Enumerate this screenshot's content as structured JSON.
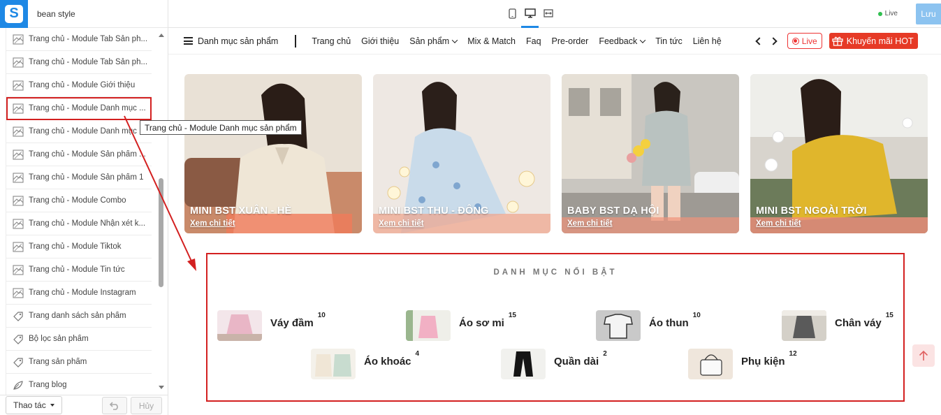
{
  "app": {
    "theme_name": "bean style",
    "save_label": "Lưu",
    "live_status": "Live",
    "action_label": "Thao tác",
    "cancel_label": "Hủy"
  },
  "sidebar": {
    "items": [
      {
        "label": "Trang chủ - Module Tab Sản ph...",
        "icon": "layout-icon"
      },
      {
        "label": "Trang chủ - Module Tab Sản ph...",
        "icon": "layout-icon"
      },
      {
        "label": "Trang chủ - Module Giới thiệu",
        "icon": "layout-icon"
      },
      {
        "label": "Trang chủ - Module Danh mục ...",
        "icon": "layout-icon",
        "selected": true
      },
      {
        "label": "Trang chủ - Module Danh mục ...",
        "icon": "layout-icon"
      },
      {
        "label": "Trang chủ - Module Sản phẩm ...",
        "icon": "layout-icon"
      },
      {
        "label": "Trang chủ - Module Sản phẩm 1",
        "icon": "layout-icon"
      },
      {
        "label": "Trang chủ - Module Combo",
        "icon": "layout-icon"
      },
      {
        "label": "Trang chủ - Module Nhận xét k...",
        "icon": "layout-icon"
      },
      {
        "label": "Trang chủ - Module Tiktok",
        "icon": "layout-icon"
      },
      {
        "label": "Trang chủ - Module Tin tức",
        "icon": "layout-icon"
      },
      {
        "label": "Trang chủ - Module Instagram",
        "icon": "layout-icon"
      },
      {
        "label": "Trang danh sách sản phẩm",
        "icon": "tag-icon"
      },
      {
        "label": "Bộ lọc sản phẩm",
        "icon": "tag-icon"
      },
      {
        "label": "Trang sản phẩm",
        "icon": "tag-icon"
      },
      {
        "label": "Trang blog",
        "icon": "blog-icon"
      }
    ],
    "tooltip": "Trang chủ - Module Danh mục sản phẩm"
  },
  "store": {
    "category_menu": "Danh mục sản phẩm",
    "nav": [
      {
        "label": "Trang chủ"
      },
      {
        "label": "Giới thiệu"
      },
      {
        "label": "Sản phẩm",
        "dropdown": true
      },
      {
        "label": "Mix & Match"
      },
      {
        "label": "Faq"
      },
      {
        "label": "Pre-order"
      },
      {
        "label": "Feedback",
        "dropdown": true
      },
      {
        "label": "Tin tức"
      },
      {
        "label": "Liên hệ"
      }
    ],
    "live_label": "Live",
    "promo_label": "Khuyến mãi HOT",
    "banners": [
      {
        "title": "MINI BST XUÂN - HÈ",
        "link": "Xem chi tiết"
      },
      {
        "title": "MINI BST THU - ĐÔNG",
        "link": "Xem chi tiết"
      },
      {
        "title": "BABY BST DẠ HỘI",
        "link": "Xem chi tiết"
      },
      {
        "title": "MINI BST NGOÀI TRỜI",
        "link": "Xem chi tiết"
      }
    ],
    "featured": {
      "title": "DANH MỤC NỔI BẬT",
      "categories": [
        {
          "name": "Váy đầm",
          "count": "10"
        },
        {
          "name": "Áo sơ mi",
          "count": "15"
        },
        {
          "name": "Áo thun",
          "count": "10"
        },
        {
          "name": "Chân váy",
          "count": "15"
        },
        {
          "name": "Áo khoác",
          "count": "4"
        },
        {
          "name": "Quần dài",
          "count": "2"
        },
        {
          "name": "Phụ kiện",
          "count": "12"
        }
      ]
    }
  },
  "colors": {
    "accent": "#1e88e5",
    "highlight": "#d32020",
    "promo": "#e63a26"
  }
}
